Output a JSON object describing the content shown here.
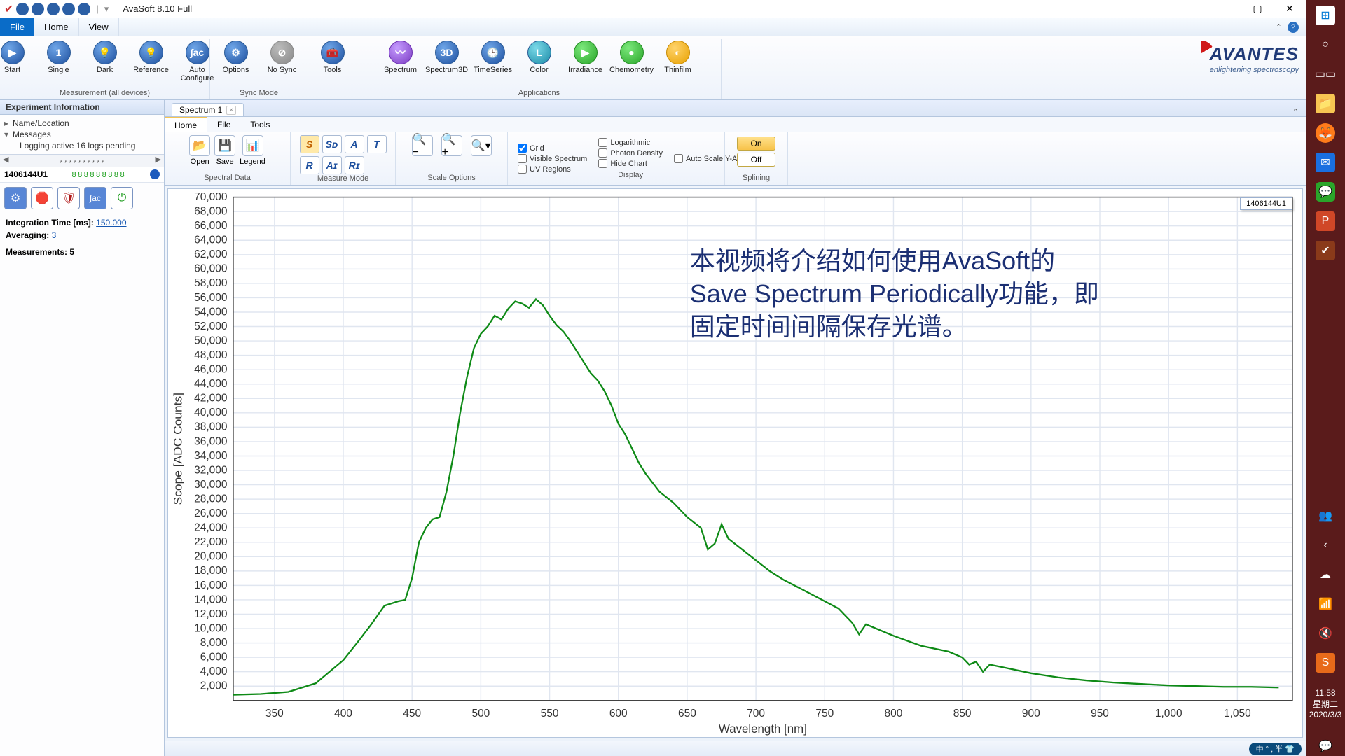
{
  "title": "AvaSoft 8.10 Full",
  "menubar": {
    "file": "File",
    "home": "Home",
    "view": "View"
  },
  "ribbon": {
    "measurement_group": "Measurement (all devices)",
    "sync_group": "Sync Mode",
    "apps_group": "Applications",
    "start": "Start",
    "single": "Single",
    "dark": "Dark",
    "reference": "Reference",
    "autoconf": "Auto Configure",
    "options": "Options",
    "nosync": "No Sync",
    "tools": "Tools",
    "spectrum": "Spectrum",
    "spectrum3d": "Spectrum3D",
    "timeseries": "TimeSeries",
    "color": "Color",
    "irradiance": "Irradiance",
    "chemometry": "Chemometry",
    "thinfilm": "Thinfilm",
    "brand": "AVANTES",
    "tagline": "enlightening spectroscopy"
  },
  "left": {
    "exp_header": "Experiment Information",
    "name_loc": "Name/Location",
    "messages": "Messages",
    "logging": "Logging active 16 logs pending",
    "device_id": "1406144U1",
    "device_status": "888888888",
    "it_label": "Integration Time  [ms]:",
    "it_value": "150.000",
    "avg_label": "Averaging:",
    "avg_value": "3",
    "meas_label": "Measurements:",
    "meas_value": "5"
  },
  "spectab": {
    "name": "Spectrum 1",
    "home": "Home",
    "file": "File",
    "tools": "Tools"
  },
  "sub": {
    "spectral_data": "Spectral Data",
    "open": "Open",
    "save": "Save",
    "legend": "Legend",
    "measure_mode": "Measure Mode",
    "scale_options": "Scale Options",
    "display": "Display",
    "splining": "Splining",
    "on": "On",
    "off": "Off",
    "grid": "Grid",
    "visible_spectrum": "Visible Spectrum",
    "uv": "UV Regions",
    "log": "Logarithmic",
    "photon": "Photon Density",
    "hide": "Hide Chart",
    "autoscale": "Auto Scale Y-Axis"
  },
  "chart_data": {
    "type": "line",
    "xlabel": "Wavelength [nm]",
    "ylabel": "Scope [ADC Counts]",
    "xlim": [
      320,
      1090
    ],
    "ylim": [
      0,
      70000
    ],
    "xticks": [
      350,
      400,
      450,
      500,
      550,
      600,
      650,
      700,
      750,
      800,
      850,
      900,
      950,
      1000,
      1050
    ],
    "yticks": [
      2000,
      4000,
      6000,
      8000,
      10000,
      12000,
      14000,
      16000,
      18000,
      20000,
      22000,
      24000,
      26000,
      28000,
      30000,
      32000,
      34000,
      36000,
      38000,
      40000,
      42000,
      44000,
      46000,
      48000,
      50000,
      52000,
      54000,
      56000,
      58000,
      60000,
      62000,
      64000,
      66000,
      68000,
      70000
    ],
    "series": [
      {
        "name": "1406144U1",
        "color": "#0e8a16",
        "x": [
          320,
          340,
          360,
          380,
          400,
          410,
          420,
          430,
          440,
          445,
          450,
          455,
          460,
          465,
          470,
          475,
          480,
          485,
          490,
          495,
          500,
          505,
          510,
          515,
          520,
          525,
          530,
          535,
          540,
          545,
          550,
          555,
          560,
          565,
          570,
          575,
          580,
          585,
          590,
          595,
          600,
          605,
          610,
          615,
          620,
          630,
          640,
          650,
          660,
          665,
          670,
          675,
          680,
          690,
          700,
          710,
          720,
          730,
          740,
          750,
          760,
          770,
          775,
          780,
          790,
          800,
          820,
          840,
          850,
          855,
          860,
          865,
          870,
          880,
          900,
          920,
          940,
          960,
          980,
          1000,
          1020,
          1040,
          1060,
          1080
        ],
        "y": [
          800,
          900,
          1200,
          2400,
          5600,
          8000,
          10500,
          13200,
          13800,
          14000,
          17000,
          22000,
          24000,
          25200,
          25500,
          29000,
          34000,
          40000,
          45000,
          49000,
          51000,
          52000,
          53500,
          53000,
          54500,
          55500,
          55200,
          54600,
          55800,
          55000,
          53500,
          52200,
          51300,
          50000,
          48500,
          47000,
          45500,
          44500,
          43000,
          41000,
          38500,
          37000,
          35000,
          33000,
          31500,
          29000,
          27500,
          25500,
          24000,
          21000,
          21800,
          24500,
          22500,
          21000,
          19500,
          18000,
          16800,
          15800,
          14800,
          13800,
          12800,
          10800,
          9200,
          10600,
          9800,
          9000,
          7600,
          6800,
          6000,
          5000,
          5400,
          4000,
          5000,
          4600,
          3800,
          3200,
          2800,
          2500,
          2300,
          2100,
          2000,
          1900,
          1900,
          1800
        ]
      }
    ],
    "legend": "1406144U1",
    "grid": true
  },
  "overlay": {
    "l1": "本视频将介绍如何使用AvaSoft的",
    "l2": "Save Spectrum Periodically功能，即",
    "l3": "固定时间间隔保存光谱。"
  },
  "statusbar": {
    "ime": "中 ° , 半 👕"
  },
  "clock": {
    "time": "11:58",
    "day": "星期二",
    "date": "2020/3/3"
  }
}
